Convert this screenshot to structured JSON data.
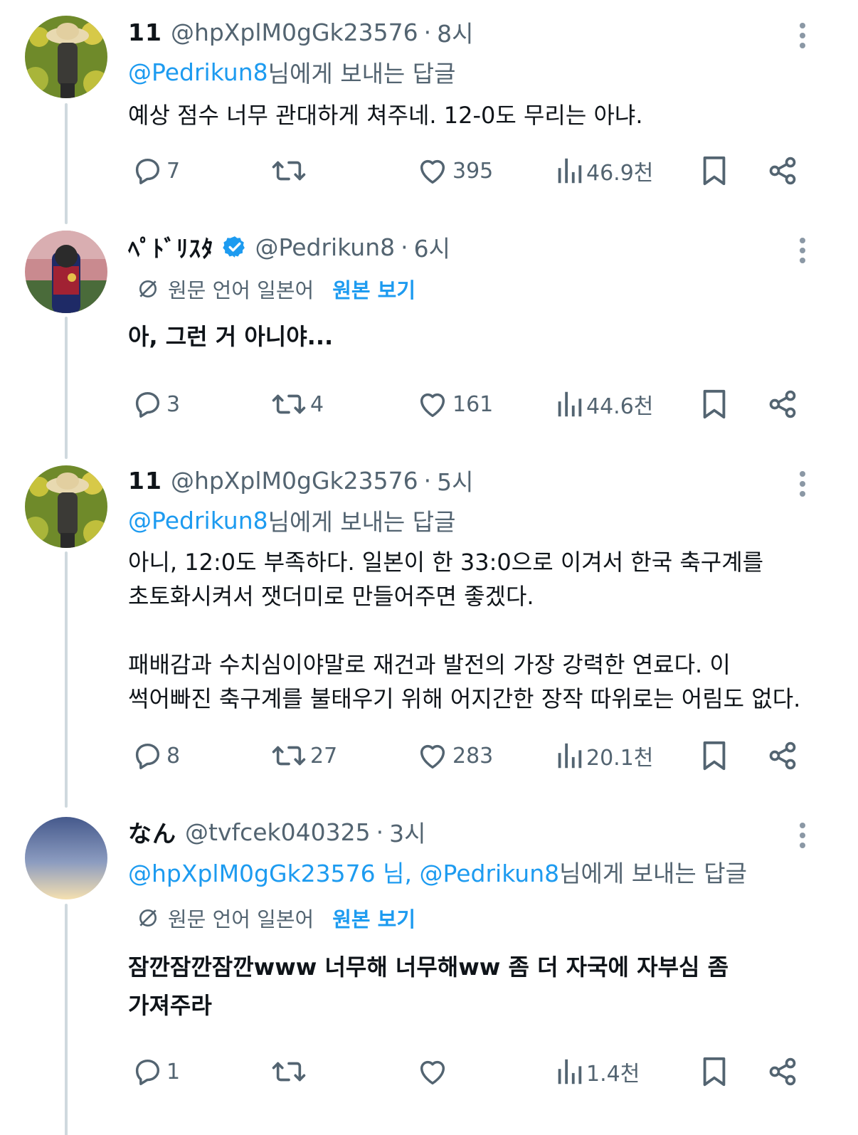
{
  "tweets": [
    {
      "name": "11",
      "handle": "@hpXplM0gGk23576",
      "time": "8시",
      "replying_mentions": "@Pedrikun8",
      "replying_suffix": " 님에게 보내는 답글",
      "body": "예상 점수 너무 관대하게 쳐주네. 12-0도 무리는 아냐.",
      "stats": {
        "replies": "7",
        "retweets": "",
        "likes": "395",
        "views": "46.9천"
      }
    },
    {
      "name": "ﾍﾟﾄﾞﾘｽﾀ",
      "verified": true,
      "handle": "@Pedrikun8",
      "time": "6시",
      "translation_label": "원문 언어 일본어",
      "translation_link": "원본 보기",
      "body": "아, 그런 거 아니야...",
      "stats": {
        "replies": "3",
        "retweets": "4",
        "likes": "161",
        "views": "44.6천"
      }
    },
    {
      "name": "11",
      "handle": "@hpXplM0gGk23576",
      "time": "5시",
      "replying_mentions": "@Pedrikun8",
      "replying_suffix": " 님에게 보내는 답글",
      "body": "아니, 12:0도 부족하다. 일본이 한 33:0으로 이겨서 한국 축구계를\n초토화시켜서 잿더미로 만들어주면 좋겠다.\n\n패배감과 수치심이야말로 재건과 발전의 가장 강력한 연료다. 이\n썩어빠진 축구계를 불태우기 위해 어지간한 장작 따위로는 어림도 없다.",
      "stats": {
        "replies": "8",
        "retweets": "27",
        "likes": "283",
        "views": "20.1천"
      }
    },
    {
      "name": "なん",
      "handle": "@tvfcek040325",
      "time": "3시",
      "replying_mentions": "@hpXplM0gGk23576 님, @Pedrikun8",
      "replying_suffix": " 님에게 보내는 답글",
      "translation_label": "원문 언어 일본어",
      "translation_link": "원본 보기",
      "body": "잠깐잠깐잠깐www 너무해 너무해ww 좀 더 자국에 자부심 좀\n가져주라",
      "stats": {
        "replies": "1",
        "retweets": "",
        "likes": "",
        "views": "1.4천"
      }
    }
  ],
  "header_dot": "·",
  "icons": {
    "reply": "reply-icon",
    "retweet": "retweet-icon",
    "like": "heart-icon",
    "views": "views-icon",
    "bookmark": "bookmark-icon",
    "share": "share-icon",
    "more": "more-icon",
    "translate": "translate-icon",
    "verified": "verified-badge-icon"
  },
  "colors": {
    "link": "#1d9bf0",
    "secondary": "#536471",
    "thread_line": "#cfd9de",
    "verified": "#1d9bf0"
  }
}
